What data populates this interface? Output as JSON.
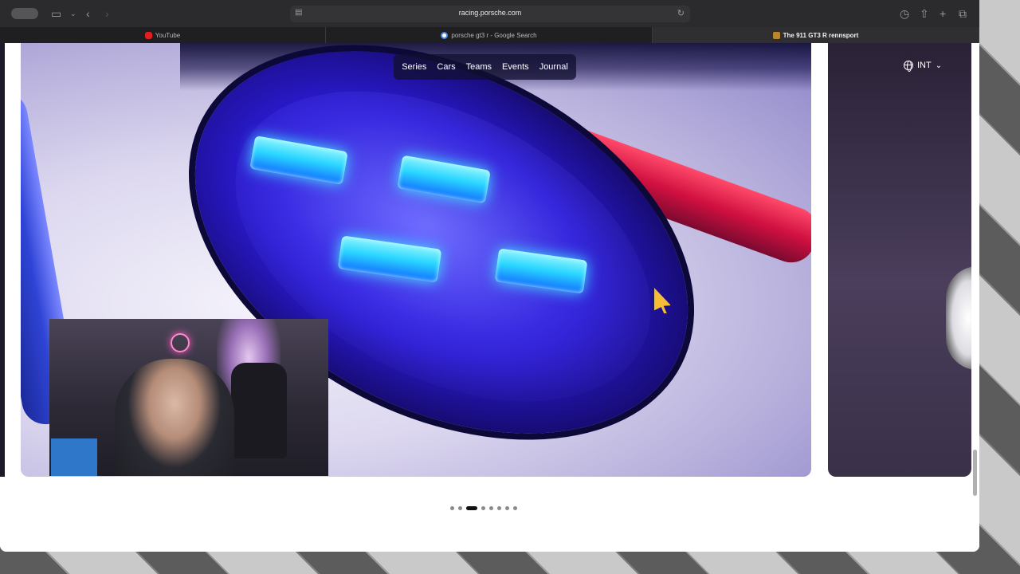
{
  "browser": {
    "address_url": "racing.porsche.com",
    "tabs": [
      {
        "label": "YouTube",
        "favicon": "youtube-icon",
        "active": false
      },
      {
        "label": "porsche gt3 r - Google Search",
        "favicon": "google-icon",
        "active": false
      },
      {
        "label": "The 911 GT3 R rennsport",
        "favicon": "porsche-icon",
        "active": true
      }
    ]
  },
  "site": {
    "nav": [
      "Series",
      "Cars",
      "Teams",
      "Events",
      "Journal"
    ],
    "language": "INT",
    "carousel": {
      "total_slides": 8,
      "active_index": 2
    }
  },
  "colors": {
    "nav_bg": "#12103280",
    "accent_led": "#2ad6ff",
    "stripe_red": "#d01040"
  }
}
